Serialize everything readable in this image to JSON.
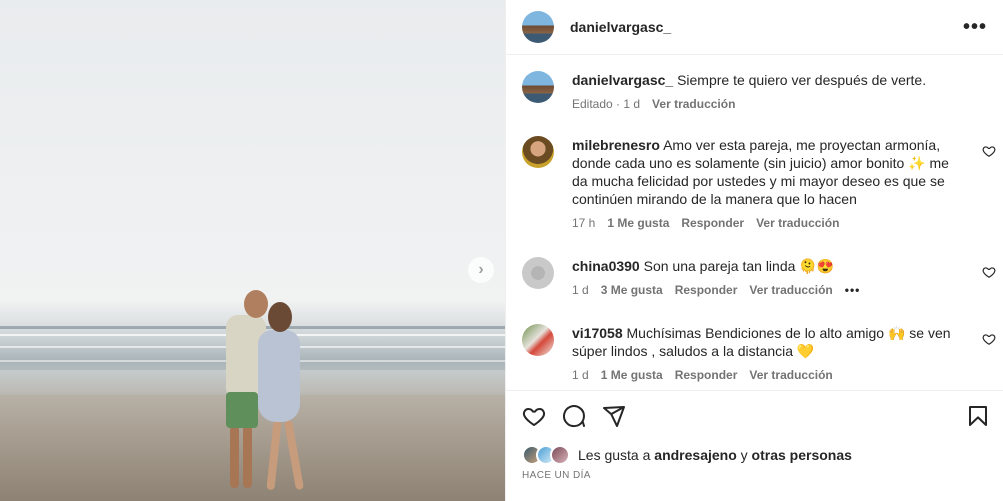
{
  "media": {
    "next_icon": "chevron-right-icon"
  },
  "post": {
    "author": "danielvargasc_",
    "more_icon": "more-horizontal-icon"
  },
  "caption": {
    "username": "danielvargasc_",
    "text": "Siempre te quiero ver después de verte.",
    "edited": "Editado · 1 d",
    "translate": "Ver traducción"
  },
  "comments": [
    {
      "username": "milebrenesro",
      "text": "Amo ver esta pareja, me proyectan armonía, donde cada uno es solamente (sin juicio) amor bonito ✨ me da mucha felicidad por ustedes y mi mayor deseo es que se continúen mirando de la manera que lo hacen",
      "time": "17 h",
      "likes": "1 Me gusta",
      "reply": "Responder",
      "translate": "Ver traducción"
    },
    {
      "username": "china0390",
      "text": "Son una pareja tan linda 🫠😍",
      "time": "1 d",
      "likes": "3 Me gusta",
      "reply": "Responder",
      "translate": "Ver traducción",
      "more": "•••"
    },
    {
      "username": "vi17058",
      "text": "Muchísimas Bendiciones de lo alto amigo 🙌 se ven súper lindos , saludos a la distancia 💛",
      "time": "1 d",
      "likes": "1 Me gusta",
      "reply": "Responder",
      "translate": "Ver traducción"
    }
  ],
  "actions": {
    "like_icon": "heart-icon",
    "comment_icon": "comment-icon",
    "share_icon": "send-icon",
    "save_icon": "bookmark-icon"
  },
  "likes": {
    "prefix": "Les gusta a",
    "user": "andresajeno",
    "joiner": "y",
    "others": "otras personas"
  },
  "timestamp": "HACE UN DÍA"
}
